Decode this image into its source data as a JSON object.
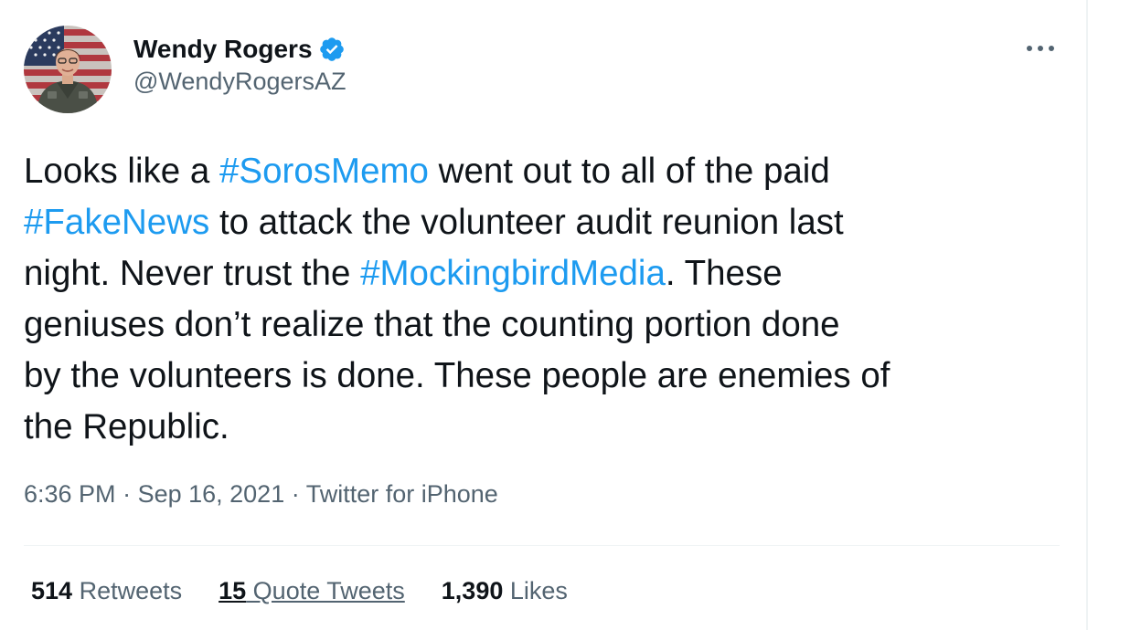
{
  "author": {
    "display_name": "Wendy Rogers",
    "handle": "@WendyRogersAZ",
    "verified": true,
    "avatar": "profile-photo"
  },
  "icons": {
    "verified": "verified-badge-icon",
    "more": "more-options-icon"
  },
  "tweet": {
    "lines": [
      [
        {
          "text": "Looks like a ",
          "type": "text"
        },
        {
          "text": "#SorosMemo",
          "type": "hashtag"
        },
        {
          "text": " went out to all of the paid",
          "type": "text"
        }
      ],
      [
        {
          "text": "#FakeNews",
          "type": "hashtag"
        },
        {
          "text": " to attack the volunteer audit reunion last",
          "type": "text"
        }
      ],
      [
        {
          "text": "night. Never trust the ",
          "type": "text"
        },
        {
          "text": "#MockingbirdMedia",
          "type": "hashtag"
        },
        {
          "text": ". These",
          "type": "text"
        }
      ],
      [
        {
          "text": "geniuses don’t realize that the counting portion done",
          "type": "text"
        }
      ],
      [
        {
          "text": "by the volunteers is done. These people are enemies of",
          "type": "text"
        }
      ],
      [
        {
          "text": "the Republic.",
          "type": "text"
        }
      ]
    ]
  },
  "meta": {
    "time": "6:36 PM",
    "separator": " · ",
    "date": "Sep 16, 2021",
    "source": "Twitter for iPhone"
  },
  "stats": {
    "retweets_count": "514",
    "retweets_label": " Retweets",
    "quotes_count": "15",
    "quotes_label": " Quote Tweets",
    "likes_count": "1,390",
    "likes_label": " Likes"
  },
  "colors": {
    "link": "#1d9bf0",
    "secondary_text": "#536471",
    "primary_text": "#0f1419",
    "divider": "#eff3f4"
  }
}
